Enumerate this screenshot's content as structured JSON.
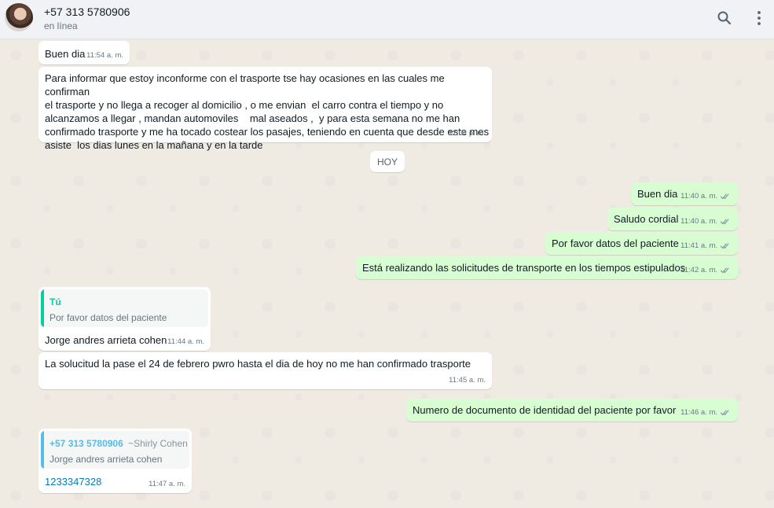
{
  "header": {
    "contact_name": "+57 313 5780906",
    "status": "en línea",
    "icons": [
      "search-icon",
      "menu-dots-icon"
    ]
  },
  "colors": {
    "incoming_bubble": "#ffffff",
    "outgoing_bubble": "#d9fdd3",
    "read_ticks": "#53bdeb",
    "quote_self_bar": "#06cf9c",
    "quote_other_bar": "#53bdeb"
  },
  "chat": {
    "day_divider": "HOY",
    "messages": [
      {
        "direction": "in",
        "text": "Buen dia",
        "time": "11:54 a. m."
      },
      {
        "direction": "in",
        "text": "Para informar que estoy inconforme con el trasporte tse hay ocasiones en las cuales me confirman\nel trasporte y no llega a recoger al domicilio , o me envian  el carro contra el tiempo y no\nalcanzamos a llegar , mandan automoviles    mal aseados ,  y para esta semana no me han\nconfirmado trasporte y me ha tocado costear los pasajes, teniendo en cuenta que desde este mes\nasiste  los dias lunes en la mañana y en la tarde",
        "time": "12:04 p. m."
      },
      {
        "direction": "out",
        "text": "Buen dia",
        "time": "11:40 a. m.",
        "status": "read"
      },
      {
        "direction": "out",
        "text": "Saludo cordial",
        "time": "11:40 a. m.",
        "status": "read"
      },
      {
        "direction": "out",
        "text": "Por favor datos del paciente",
        "time": "11:41 a. m.",
        "status": "read"
      },
      {
        "direction": "out",
        "text": "Está realizando las solicitudes de transporte en los tiempos estipulados",
        "time": "11:42 a. m.",
        "status": "read"
      },
      {
        "direction": "in",
        "quote": {
          "author": "Tú",
          "text": "Por favor datos del paciente"
        },
        "text": "Jorge andres arrieta cohen",
        "time": "11:44 a. m."
      },
      {
        "direction": "in",
        "text": "La solucitud la pase el 24 de febrero pwro hasta el dia de hoy no me han confirmado trasporte",
        "time": "11:45 a. m."
      },
      {
        "direction": "out",
        "text": "Numero de documento de identidad del paciente por favor",
        "time": "11:46 a. m.",
        "status": "read"
      },
      {
        "direction": "in",
        "quote": {
          "author": "+57 313 5780906",
          "author_alias": "~Shirly Cohen",
          "text": "Jorge andres arrieta cohen"
        },
        "text": "1233347328",
        "time": "11:47 a. m."
      }
    ]
  }
}
